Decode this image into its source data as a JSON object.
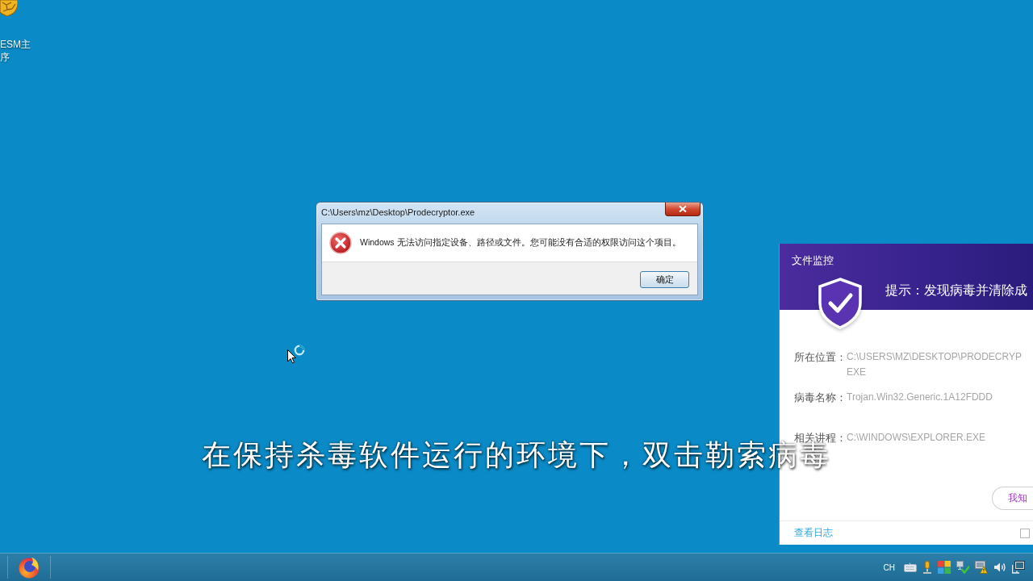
{
  "desktop_icon": {
    "label_lines": [
      "ESM主",
      "序"
    ]
  },
  "dialog": {
    "title": "C:\\Users\\mz\\Desktop\\Prodecryptor.exe",
    "message": "Windows 无法访问指定设备、路径或文件。您可能没有合适的权限访问这个项目。",
    "buttons": [
      "确定"
    ]
  },
  "cursor": {
    "busy": true
  },
  "alert_panel": {
    "title": "文件监控",
    "heading": "提示：发现病毒并清除成",
    "fields": [
      {
        "label": "所在位置：",
        "value_lines": [
          "C:\\USERS\\MZ\\DESKTOP\\PRODECRYP",
          "EXE"
        ]
      },
      {
        "label": "病毒名称：",
        "value_lines": [
          "Trojan.Win32.Generic.1A12FDDD"
        ]
      },
      {
        "label": "相关讲程：",
        "value_lines": [
          "C:\\WINDOWS\\EXPLORER.EXE"
        ]
      }
    ],
    "button": "我知",
    "link": "查看日志",
    "checkbox": {
      "checked": false
    }
  },
  "subtitle": "在保持杀毒软件运行的环境下，双击勒索病毒",
  "taskbar": {
    "tray": {
      "language": "CH"
    }
  }
}
